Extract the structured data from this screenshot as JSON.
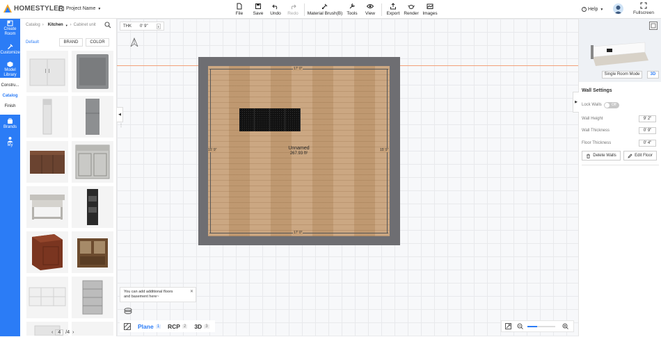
{
  "header": {
    "brand": "HOMESTYLER",
    "project_name": "Project Name",
    "tools": [
      {
        "label": "File",
        "icon": "file-icon",
        "disabled": false
      },
      {
        "label": "Save",
        "icon": "save-icon",
        "disabled": false
      },
      {
        "label": "Undo",
        "icon": "undo-icon",
        "disabled": false
      },
      {
        "label": "Redo",
        "icon": "redo-icon",
        "disabled": true
      },
      {
        "label": "Material Brush(B)",
        "icon": "brush-icon",
        "disabled": false
      },
      {
        "label": "Tools",
        "icon": "tools-icon",
        "disabled": false
      },
      {
        "label": "View",
        "icon": "eye-icon",
        "disabled": false
      },
      {
        "label": "Export",
        "icon": "export-icon",
        "disabled": false
      },
      {
        "label": "Render",
        "icon": "teapot-icon",
        "disabled": false
      },
      {
        "label": "Images",
        "icon": "images-icon",
        "disabled": false
      }
    ],
    "help": "Help",
    "fullscreen": "Fullscreen"
  },
  "leftnav": {
    "items": [
      {
        "label1": "Create",
        "label2": "Room",
        "icon": "create-room-icon"
      },
      {
        "label1": "Customize",
        "label2": "",
        "icon": "customize-icon"
      },
      {
        "label1": "Model",
        "label2": "Library",
        "icon": "model-library-icon"
      }
    ],
    "sub_items": [
      "Constru...",
      "Catalog",
      "Finish"
    ],
    "items2": [
      {
        "label1": "Brands",
        "label2": "",
        "icon": "brands-icon"
      },
      {
        "label1": "My",
        "label2": "",
        "icon": "user-icon"
      }
    ]
  },
  "catalog": {
    "crumb_root": "Catalog",
    "crumb_current": "Kitchen",
    "crumb_leaf": "Cabinet unit",
    "filter_default": "Default",
    "filter_brand": "BRAND",
    "filter_color": "COLOR",
    "page_current": "4",
    "page_total": "/4",
    "products": [
      "white-double-cabinet",
      "gray-base-cabinet",
      "narrow-white-cabinet",
      "tall-gray-cabinet",
      "wood-sideboard",
      "gray-vanity-cabinet",
      "kitchen-island",
      "black-wine-rack",
      "cherry-corner-cabinet",
      "wood-hutch",
      "white-drawer-console",
      "steel-drawer-cabinet",
      "white-partial-cabinet",
      "empty-slot"
    ]
  },
  "canvas": {
    "thk_label": "THK",
    "thk_value": "0' 9\"",
    "room_name": "Unnamed",
    "room_area": "267.93 ft²",
    "dim_top": "17' 0\"",
    "dim_bottom": "17' 0\"",
    "dim_left": "15' 9\"",
    "dim_right": "15' 9\"",
    "tip_line1": "You can add additional floors",
    "tip_line2": "and basement here~",
    "views": [
      {
        "label": "Plane",
        "num": "1",
        "active": true
      },
      {
        "label": "RCP",
        "num": "2",
        "active": false
      },
      {
        "label": "3D",
        "num": "3",
        "active": false
      }
    ],
    "zoom_fraction": 0.35
  },
  "right_panel": {
    "single_room_mode": "Single Room Mode",
    "view_3d": "3D",
    "title": "Wall Settings",
    "lock_walls": "Lock Walls",
    "lock_state": "Off",
    "wall_height_label": "Wall Height",
    "wall_height": "9' 2\"",
    "wall_thickness_label": "Wall Thickness",
    "wall_thickness": "0' 9\"",
    "floor_thickness_label": "Floor Thickness",
    "floor_thickness": "0' 4\"",
    "delete_walls": "Delete Walls",
    "edit_floor": "Edit Floor"
  },
  "colors": {
    "accent": "#2b7cf6",
    "wall": "#6e6e72",
    "floor": "#c8a27a"
  }
}
